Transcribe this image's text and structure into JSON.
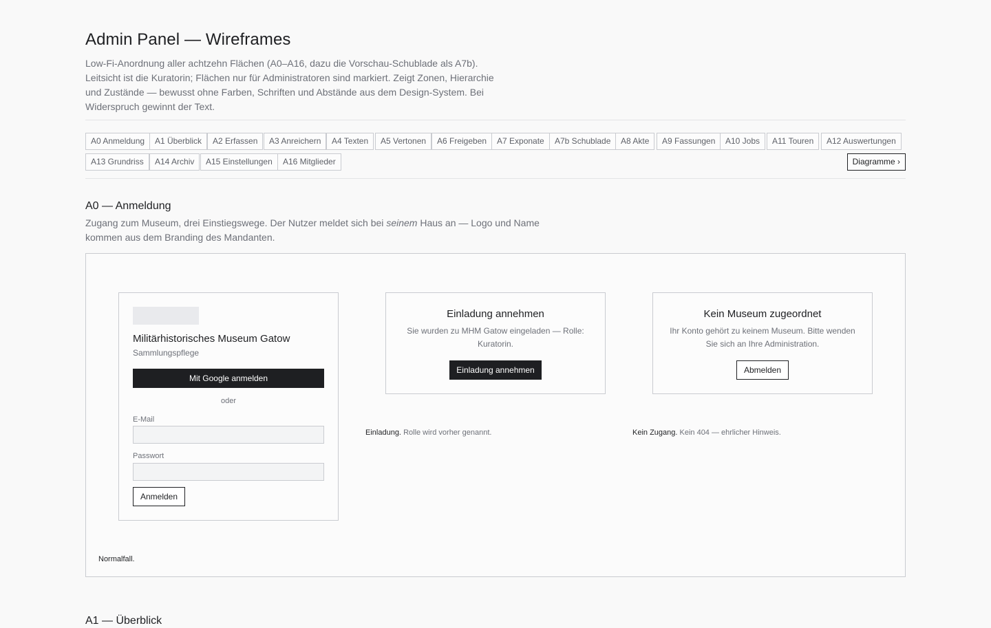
{
  "header": {
    "title": "Admin Panel — Wireframes",
    "intro": "Low-Fi-Anordnung aller achtzehn Flächen (A0–A16, dazu die Vorschau-Schublade als A7b). Leitsicht ist die Kuratorin; Flächen nur für Administratoren sind markiert. Zeigt Zonen, Hierarchie und Zustände — bewusst ohne Farben, Schriften und Abstände aus dem Design-System. Bei Widerspruch gewinnt der Text."
  },
  "nav": {
    "chips": [
      "A0 Anmeldung",
      "A1 Überblick",
      "A2 Erfassen",
      "A3 Anreichern",
      "A4 Texten",
      "A5 Vertonen",
      "A6 Freigeben",
      "A7 Exponate",
      "A7b Schublade",
      "A8 Akte",
      "A9 Fassungen",
      "A10 Jobs",
      "A11 Touren",
      "A12 Auswertungen",
      "A13 Grundriss",
      "A14 Archiv",
      "A15 Einstellungen",
      "A16 Mitglieder"
    ],
    "diagrams_link": "Diagramme ›"
  },
  "section_a0": {
    "title": "A0 — Anmeldung",
    "desc_before": "Zugang zum Museum, drei Einstiegswege. Der Nutzer meldet sich bei ",
    "desc_em": "seinem",
    "desc_after": " Haus an — Logo und Name kommen aus dem Branding des Mandanten.",
    "login_card": {
      "museum_name": "Militärhistorisches Museum Gatow",
      "museum_subtitle": "Sammlungspflege",
      "google_button": "Mit Google anmelden",
      "or_label": "oder",
      "email_label": "E-Mail",
      "email_value": "",
      "password_label": "Passwort",
      "password_value": "",
      "submit_button": "Anmelden"
    },
    "invite_card": {
      "heading": "Einladung annehmen",
      "text": "Sie wurden zu MHM Gatow eingeladen — Rolle: Kuratorin.",
      "button": "Einladung annehmen"
    },
    "no_museum_card": {
      "heading": "Kein Museum zugeordnet",
      "text": "Ihr Konto gehört zu keinem Museum. Bitte wenden Sie sich an Ihre Administration.",
      "button": "Abmelden"
    },
    "notes": {
      "normal": "Normalfall.",
      "invite_label": "Einladung.",
      "invite_text": "Rolle wird vorher genannt.",
      "no_access_label": "Kein Zugang.",
      "no_access_text": "Kein 404 — ehrlicher Hinweis."
    }
  },
  "section_a1": {
    "title": "A1 — Überblick"
  }
}
